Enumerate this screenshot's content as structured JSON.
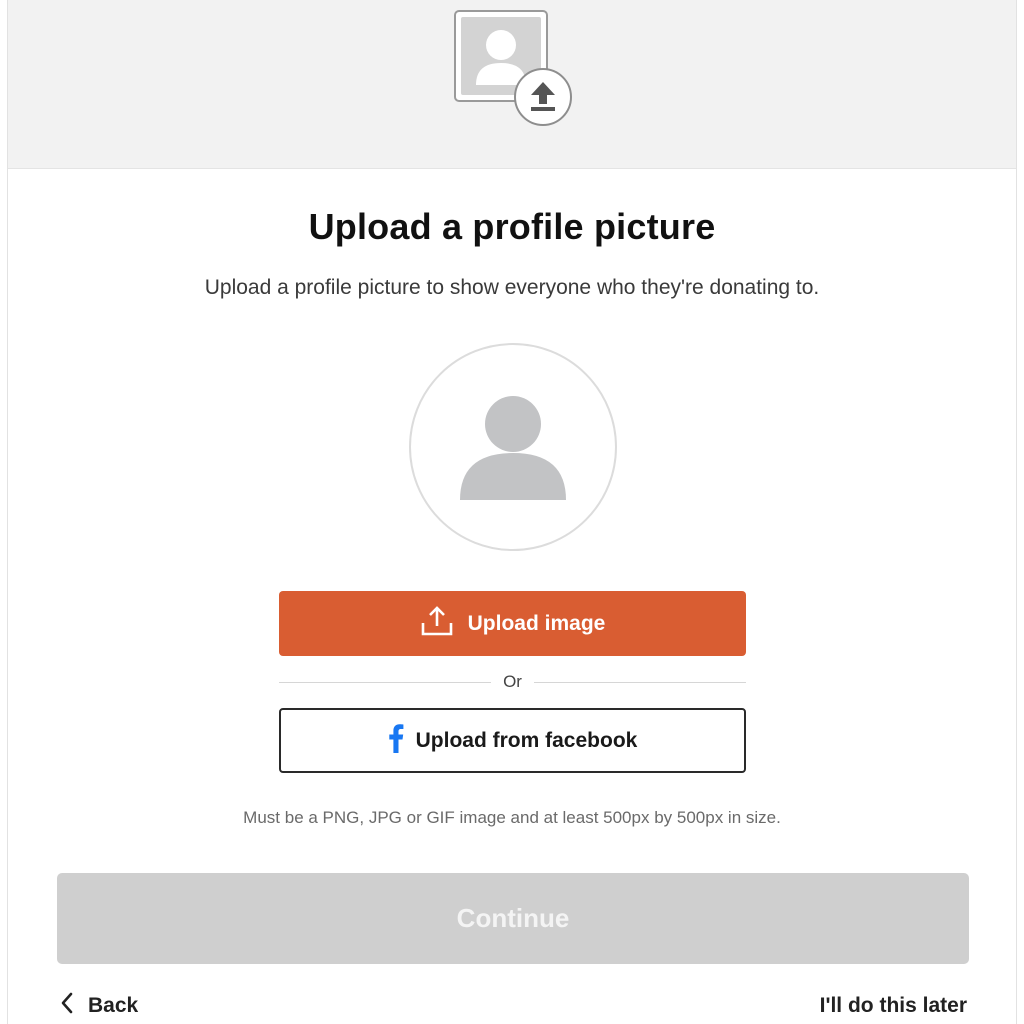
{
  "header": {
    "illustration_icon": "profile-upload-icon",
    "badge_icon": "upload-arrow-icon"
  },
  "main": {
    "title": "Upload a profile picture",
    "subtitle": "Upload a profile picture to show everyone who they're donating to.",
    "avatar_icon": "person-placeholder-icon"
  },
  "actions": {
    "upload_label": "Upload image",
    "upload_icon": "upload-icon",
    "divider_text": "Or",
    "facebook_label": "Upload from facebook",
    "facebook_icon": "facebook-icon",
    "requirements": "Must be a PNG, JPG or GIF image and at least 500px by 500px in size.",
    "continue_label": "Continue",
    "continue_disabled": true
  },
  "footer": {
    "back_label": "Back",
    "back_icon": "chevron-left-icon",
    "later_label": "I'll do this later"
  },
  "colors": {
    "primary": "#d95d32",
    "facebook_blue": "#1877f2",
    "disabled": "#cfcfcf",
    "placeholder_gray": "#c2c3c5"
  }
}
